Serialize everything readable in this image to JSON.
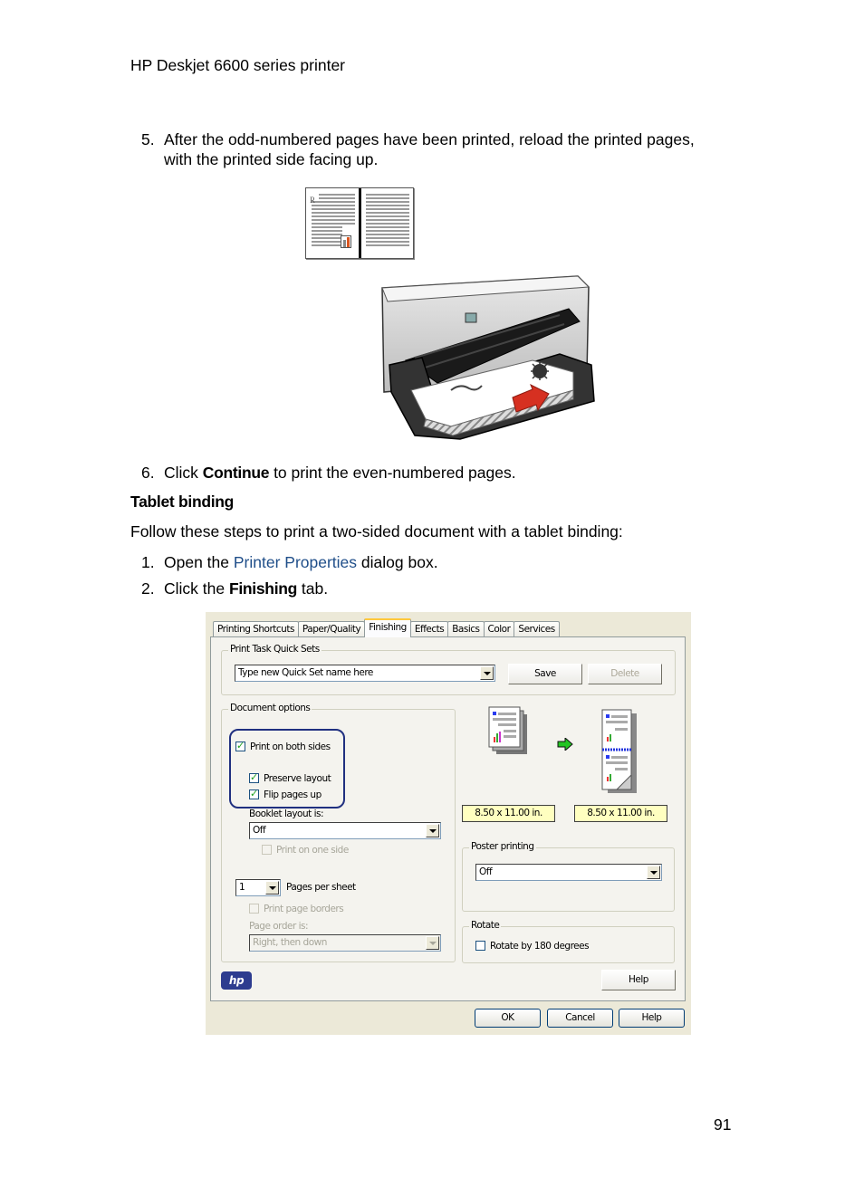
{
  "running_header": "HP Deskjet 6600 series printer",
  "steps_part1": [
    {
      "number": "5.",
      "line1": "After the odd-numbered pages have been printed, reload the printed pages,",
      "line2": "with the printed side facing up."
    },
    {
      "number": "6.",
      "prefix": "Click ",
      "bold": "Continue",
      "suffix": " to print the even-numbered pages."
    }
  ],
  "section_heading": "Tablet binding",
  "intro_paragraph": "Follow these steps to print a two-sided document with a tablet binding:",
  "steps_part2": [
    {
      "number": "1.",
      "prefix": "Open the ",
      "link": "Printer Properties",
      "suffix": " dialog box."
    },
    {
      "number": "2.",
      "prefix": "Click the ",
      "bold": "Finishing",
      "suffix": " tab."
    }
  ],
  "illustrations": {
    "book_letter": "R",
    "printer_logo": "hp"
  },
  "dialog": {
    "tabs": [
      {
        "label": "Printing Shortcuts",
        "active": false
      },
      {
        "label": "Paper/Quality",
        "active": false
      },
      {
        "label": "Finishing",
        "active": true
      },
      {
        "label": "Effects",
        "active": false
      },
      {
        "label": "Basics",
        "active": false
      },
      {
        "label": "Color",
        "active": false
      },
      {
        "label": "Services",
        "active": false
      }
    ],
    "quick_sets": {
      "legend": "Print Task Quick Sets",
      "combo_value": "Type new Quick Set name here",
      "save_label": "Save",
      "delete_label": "Delete"
    },
    "document_options": {
      "legend": "Document options",
      "print_both_sides": {
        "label": "Print on both sides",
        "checked": true
      },
      "preserve_layout": {
        "label": "Preserve layout",
        "checked": true
      },
      "flip_pages_up": {
        "label": "Flip pages up",
        "checked": true
      },
      "booklet_label": "Booklet layout is:",
      "booklet_value": "Off",
      "print_one_side": {
        "label": "Print on one side",
        "checked": false,
        "disabled": true
      },
      "pages_per_sheet_value": "1",
      "pages_per_sheet_label": "Pages per sheet",
      "print_page_borders": {
        "label": "Print page borders",
        "checked": false,
        "disabled": true
      },
      "page_order_label": "Page order is:",
      "page_order_value": "Right, then down"
    },
    "preview": {
      "source_size": "8.50 x 11.00 in.",
      "output_size": "8.50 x 11.00 in."
    },
    "poster_printing": {
      "legend": "Poster printing",
      "value": "Off"
    },
    "rotate": {
      "legend": "Rotate",
      "rotate_180": {
        "label": "Rotate by 180 degrees",
        "checked": false
      }
    },
    "panel_help_label": "Help",
    "logo_text": "hp",
    "ok_label": "OK",
    "cancel_label": "Cancel",
    "help_label": "Help"
  },
  "page_number": "91"
}
